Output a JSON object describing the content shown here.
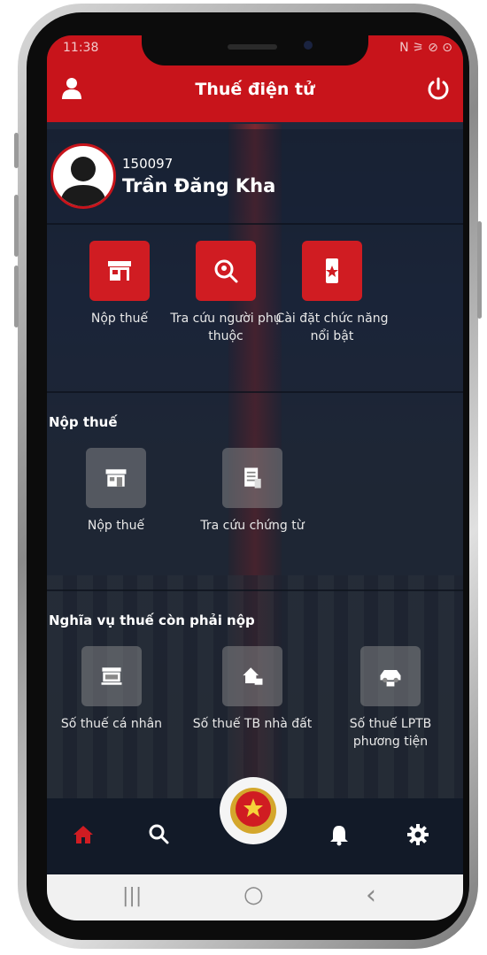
{
  "status_bar": {
    "time": "11:38",
    "right": "N ⚞ ⊘ ⊙"
  },
  "app_bar": {
    "title": "Thuế điện tử"
  },
  "user": {
    "id": "150097",
    "name": "Trần Đăng Kha"
  },
  "quick_actions": [
    {
      "label": "Nộp thuế",
      "icon": "shop-icon"
    },
    {
      "label": "Tra cứu người phụ thuộc",
      "icon": "search-person-icon"
    },
    {
      "label": "Cài đặt chức năng nổi bật",
      "icon": "phone-star-icon"
    }
  ],
  "section_nop_thue": {
    "title": "Nộp thuế",
    "items": [
      {
        "label": "Nộp thuế",
        "icon": "shop-icon"
      },
      {
        "label": "Tra cứu chứng từ",
        "icon": "document-icon"
      }
    ]
  },
  "section_nghia_vu": {
    "title": "Nghĩa vụ thuế còn phải nộp",
    "items": [
      {
        "label": "Số thuế cá nhân",
        "icon": "store-icon"
      },
      {
        "label": "Số thuế TB nhà đất",
        "icon": "house-icon"
      },
      {
        "label": "Số thuế LPTB phương tiện",
        "icon": "car-icon"
      }
    ]
  },
  "bottom_nav": [
    "home-icon",
    "search-icon",
    "emblem-icon",
    "bell-icon",
    "settings-icon"
  ],
  "android_nav": {
    "recent": "|||",
    "home": "○",
    "back": "‹"
  },
  "colors": {
    "brand_red": "#c8141b",
    "tile_red": "#d01c22",
    "nav_bg": "#121a28"
  }
}
